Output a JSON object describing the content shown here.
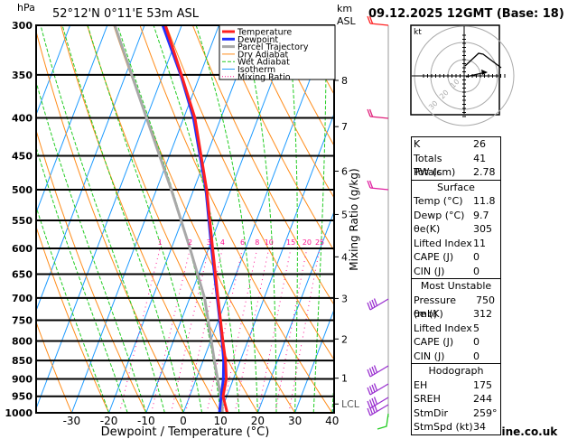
{
  "header": {
    "location": "52°12'N  0°11'E  53m  ASL",
    "datetime": "09.12.2025  12GMT  (Base: 18)",
    "left_unit": "hPa",
    "right_unit_top": "km",
    "right_unit_bottom": "ASL"
  },
  "hodograph": {
    "unit_label": "kt",
    "ring_labels": [
      "10",
      "20",
      "30"
    ]
  },
  "indices": {
    "rows": [
      {
        "label": "K",
        "value": "26"
      },
      {
        "label": "Totals Totals",
        "value": "41"
      },
      {
        "label": "PW (cm)",
        "value": "2.78"
      }
    ]
  },
  "surface": {
    "title": "Surface",
    "rows": [
      {
        "label": "Temp (°C)",
        "value": "11.8"
      },
      {
        "label": "Dewp (°C)",
        "value": "9.7"
      },
      {
        "label": "θe(K)",
        "value": "305"
      },
      {
        "label": "Lifted Index",
        "value": "11"
      },
      {
        "label": "CAPE (J)",
        "value": "0"
      },
      {
        "label": "CIN (J)",
        "value": "0"
      }
    ]
  },
  "most_unstable": {
    "title": "Most Unstable",
    "rows": [
      {
        "label": "Pressure (mb)",
        "value": "750"
      },
      {
        "label": "θe (K)",
        "value": "312"
      },
      {
        "label": "Lifted Index",
        "value": "5"
      },
      {
        "label": "CAPE (J)",
        "value": "0"
      },
      {
        "label": "CIN (J)",
        "value": "0"
      }
    ]
  },
  "hodograph_stats": {
    "title": "Hodograph",
    "rows": [
      {
        "label": "EH",
        "value": "175"
      },
      {
        "label": "SREH",
        "value": "244"
      },
      {
        "label": "StmDir",
        "value": "259°"
      },
      {
        "label": "StmSpd (kt)",
        "value": "34"
      }
    ]
  },
  "footer": {
    "copyright": "© weatheronline.co.uk"
  },
  "chart_data": {
    "type": "line",
    "subtype": "skew-T log-p",
    "xlabel": "Dewpoint / Temperature (°C)",
    "ylabel": "hPa",
    "y2label": "Mixing Ratio (g/kg)",
    "xlim": [
      -40,
      40
    ],
    "ylim": [
      1000,
      300
    ],
    "y_scale": "log",
    "x_ticks": [
      -30,
      -20,
      -10,
      0,
      10,
      20,
      30,
      40
    ],
    "pressure_ticks": [
      300,
      350,
      400,
      450,
      500,
      550,
      600,
      650,
      700,
      750,
      800,
      850,
      900,
      950,
      1000
    ],
    "km_ticks": [
      {
        "label": "8",
        "p": 356
      },
      {
        "label": "7",
        "p": 411
      },
      {
        "label": "6",
        "p": 472
      },
      {
        "label": "5",
        "p": 540
      },
      {
        "label": "4",
        "p": 616
      },
      {
        "label": "3",
        "p": 701
      },
      {
        "label": "2",
        "p": 795
      },
      {
        "label": "1",
        "p": 898
      },
      {
        "label": "LCL",
        "p": 973
      }
    ],
    "mixing_ratio_labels": [
      "1",
      "2",
      "3",
      "4",
      "6",
      "8",
      "10",
      "15",
      "20",
      "25"
    ],
    "mixing_ratio_label_p": 600,
    "legend": {
      "placement": "top-right",
      "entries": [
        {
          "name": "Temperature",
          "color": "#ff2020"
        },
        {
          "name": "Dewpoint",
          "color": "#2030ff"
        },
        {
          "name": "Parcel Trajectory",
          "color": "#a8a8a8"
        },
        {
          "name": "Dry Adiabat",
          "color": "#ff8c1a"
        },
        {
          "name": "Wet Adiabat",
          "color": "#22cc22"
        },
        {
          "name": "Isotherm",
          "color": "#1e9bff"
        },
        {
          "name": "Mixing Ratio",
          "color": "#ff1493"
        }
      ]
    },
    "series": [
      {
        "name": "Temperature",
        "color": "#ff2020",
        "pressure": [
          1000,
          950,
          900,
          850,
          800,
          700,
          600,
          500,
          400,
          350,
          300
        ],
        "values": [
          11.8,
          9.0,
          8.1,
          6.0,
          3.3,
          -2.4,
          -8.9,
          -16.5,
          -27.0,
          -35.0,
          -44.4
        ]
      },
      {
        "name": "Dewpoint",
        "color": "#2030ff",
        "pressure": [
          1000,
          950,
          900,
          850,
          800,
          700,
          600,
          500,
          400,
          350,
          300
        ],
        "values": [
          9.7,
          8.5,
          7.3,
          5.5,
          3.1,
          -2.6,
          -9.2,
          -16.7,
          -27.4,
          -35.2,
          -45.1
        ]
      },
      {
        "name": "Parcel Trajectory",
        "color": "#a8a8a8",
        "pressure": [
          1000,
          973,
          850,
          700,
          600,
          500,
          400,
          300
        ],
        "values": [
          10.5,
          9.5,
          3.0,
          -6.0,
          -15.0,
          -26.0,
          -40.0,
          -58.0
        ]
      }
    ]
  }
}
